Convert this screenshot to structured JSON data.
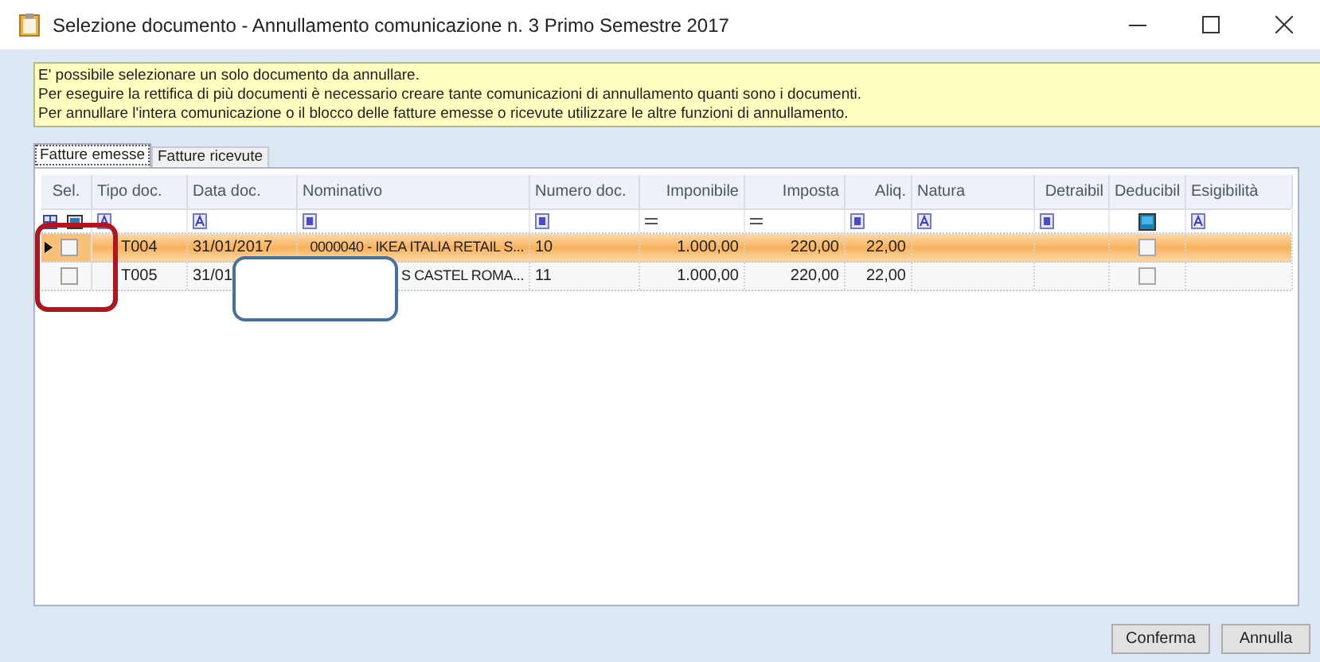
{
  "window": {
    "title": "Selezione documento - Annullamento comunicazione n. 3 Primo Semestre 2017"
  },
  "notice": [
    "E' possibile selezionare un solo documento da annullare.",
    "Per eseguire la rettifica di più documenti è necessario creare tante comunicazioni di annullamento quanti sono i documenti.",
    "Per annullare l'intera comunicazione o il blocco delle fatture emesse o ricevute utilizzare le altre funzioni di annullamento."
  ],
  "tabs": [
    {
      "label": "Fatture emesse",
      "selected": true
    },
    {
      "label": "Fatture ricevute",
      "selected": false
    }
  ],
  "table": {
    "columns": [
      "Sel.",
      "Tipo doc.",
      "Data doc.",
      "Nominativo",
      "Numero doc.",
      "Imponibile",
      "Imposta",
      "Aliq.",
      "Natura",
      "Detraibil",
      "Deducibil",
      "Esigibilità"
    ],
    "filters": [
      {
        "kind": "sel"
      },
      {
        "kind": "text"
      },
      {
        "kind": "text"
      },
      {
        "kind": "list"
      },
      {
        "kind": "list"
      },
      {
        "kind": "equals"
      },
      {
        "kind": "equals"
      },
      {
        "kind": "list"
      },
      {
        "kind": "text"
      },
      {
        "kind": "list"
      },
      {
        "kind": "check"
      },
      {
        "kind": "text"
      }
    ],
    "rows": [
      {
        "selected": true,
        "checked": false,
        "deducibile": false,
        "cells": [
          "",
          "T004",
          "31/01/2017",
          "0000040 - IKEA ITALIA RETAIL S...",
          "10",
          "1.000,00",
          "220,00",
          "22,00",
          "",
          "",
          "",
          ""
        ]
      },
      {
        "selected": false,
        "checked": false,
        "deducibile": false,
        "cells": [
          "",
          "T005",
          "31/01",
          "S CASTEL ROMA...",
          "11",
          "1.000,00",
          "220,00",
          "22,00",
          "",
          "",
          "",
          ""
        ]
      }
    ]
  },
  "buttons": [
    "Conferma",
    "Annulla"
  ]
}
